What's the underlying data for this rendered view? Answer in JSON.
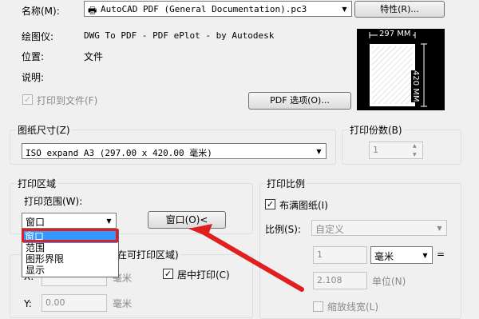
{
  "printer": {
    "name_label": "名称(M):",
    "name_value": "AutoCAD PDF (General Documentation).pc3",
    "properties_button": "特性(R)...",
    "plotter_label": "绘图仪:",
    "plotter_value": "DWG To PDF - PDF ePlot - by Autodesk",
    "where_label": "位置:",
    "where_value": "文件",
    "desc_label": "说明:",
    "print_to_file": "打印到文件(F)",
    "pdf_options_button": "PDF 选项(O)..."
  },
  "preview": {
    "width_label": "297 MM",
    "height_label": "420 MM"
  },
  "paper_size": {
    "title": "图纸尺寸(Z)",
    "value": "ISO expand A3 (297.00 x 420.00 毫米)"
  },
  "copies": {
    "title": "打印份数(B)",
    "value": "1"
  },
  "plot_area": {
    "title": "打印区域",
    "range_label": "打印范围(W):",
    "range_value": "窗口",
    "window_button": "窗口(O)<",
    "options": [
      "窗口",
      "范围",
      "图形界限",
      "显示"
    ]
  },
  "offset": {
    "title_fragment": "在可打印区域)",
    "x_label": "X:",
    "x_unit": "毫米",
    "y_label": "Y:",
    "y_value": "0.00",
    "y_unit": "毫米",
    "center_label": "居中打印(C)"
  },
  "scale": {
    "title": "打印比例",
    "fit_label": "布满图纸(I)",
    "scale_label": "比例(S):",
    "scale_value": "自定义",
    "num_value": "1",
    "unit_value": "毫米",
    "equals": "=",
    "denom_value": "2.108",
    "denom_unit": "单位(N)",
    "lineweight_label": "缩放线宽(L)"
  },
  "colors": {
    "highlight_red": "#e02020",
    "selection_blue": "#3399ff"
  }
}
